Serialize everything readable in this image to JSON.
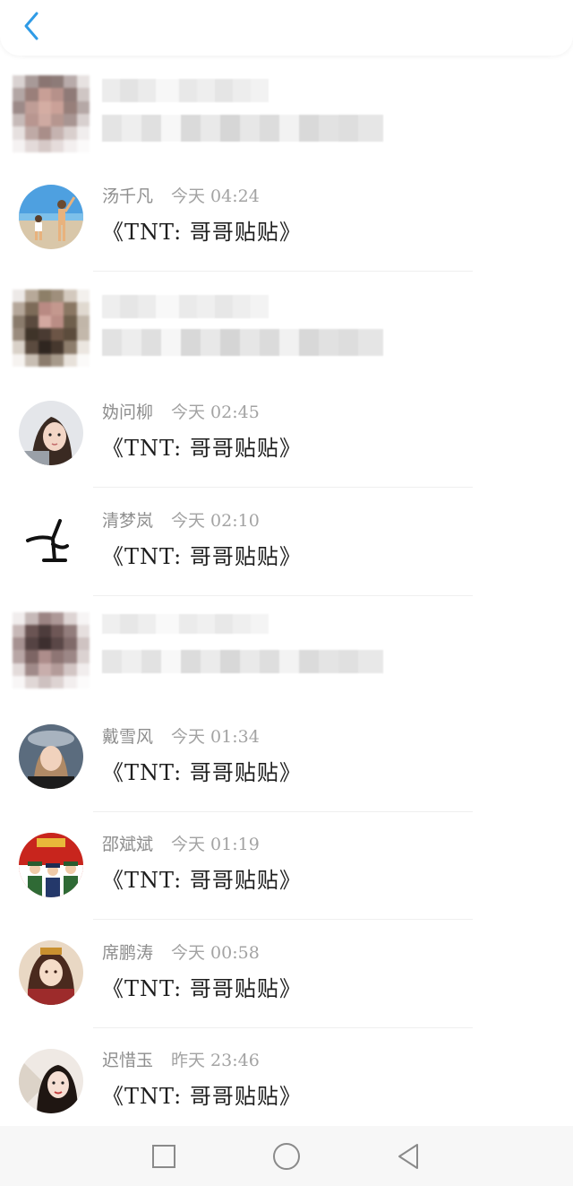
{
  "header": {
    "back_icon": "chevron-left-icon",
    "accent_color": "#2f9be6"
  },
  "comments": [
    {
      "redacted": true
    },
    {
      "redacted": false,
      "user": "汤千凡",
      "time": "今天 04:24",
      "text": "《TNT: 哥哥贴贴》",
      "avatar": "beach-photo"
    },
    {
      "redacted": true
    },
    {
      "redacted": false,
      "user": "妫问柳",
      "time": "今天 02:45",
      "text": "《TNT: 哥哥贴贴》",
      "avatar": "selfie-girl"
    },
    {
      "redacted": false,
      "user": "清梦岚",
      "time": "今天 02:10",
      "text": "《TNT: 哥哥贴贴》",
      "avatar": "stick-figure"
    },
    {
      "redacted": true
    },
    {
      "redacted": false,
      "user": "戴雪风",
      "time": "今天 01:34",
      "text": "《TNT: 哥哥贴贴》",
      "avatar": "girl-with-hat"
    },
    {
      "redacted": false,
      "user": "邵斌斌",
      "time": "今天 01:19",
      "text": "《TNT: 哥哥贴贴》",
      "avatar": "military-parade"
    },
    {
      "redacted": false,
      "user": "席鹏涛",
      "time": "今天 00:58",
      "text": "《TNT: 哥哥贴贴》",
      "avatar": "anime-character"
    },
    {
      "redacted": false,
      "user": "迟惜玉",
      "time": "昨天 23:46",
      "text": "《TNT: 哥哥贴贴》",
      "avatar": "girl-with-fan"
    }
  ],
  "navbar": {
    "buttons": [
      "recent-apps-square-icon",
      "home-circle-icon",
      "back-triangle-icon"
    ]
  }
}
